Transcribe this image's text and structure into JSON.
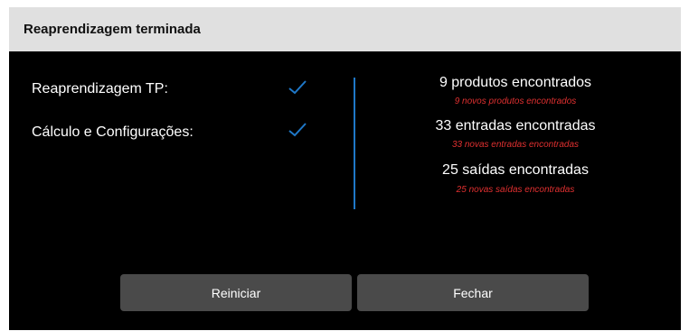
{
  "dialog": {
    "title": "Reaprendizagem terminada",
    "tasks": [
      {
        "label": "Reaprendizagem TP:",
        "icon": "checkmark-icon",
        "status": "done"
      },
      {
        "label": "Cálculo e Configurações:",
        "icon": "checkmark-icon",
        "status": "done"
      }
    ],
    "results": [
      {
        "main": "9 produtos encontrados",
        "sub": "9 novos produtos encontrados"
      },
      {
        "main": "33 entradas encontradas",
        "sub": "33 novas entradas encontradas"
      },
      {
        "main": "25 saídas encontradas",
        "sub": "25 novas saídas encontradas"
      }
    ],
    "buttons": {
      "restart": "Reiniciar",
      "close": "Fechar"
    }
  },
  "colors": {
    "background": "#000000",
    "titlebar": "#e0e0e0",
    "accent": "#1f78c8",
    "sub_text": "#e03030",
    "button": "#4a4a4a"
  }
}
